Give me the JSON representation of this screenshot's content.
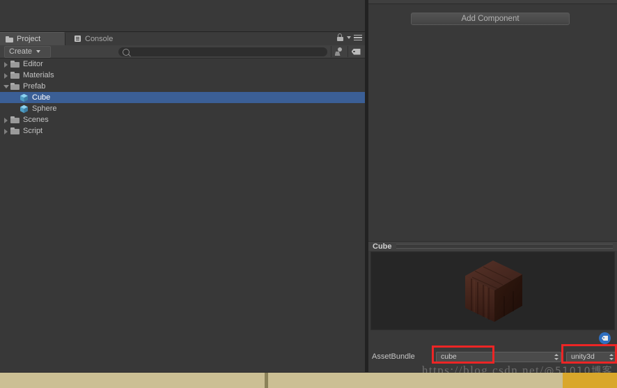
{
  "window": {
    "theme": "unity-dark",
    "accent_selection": "#3b5f96",
    "annotation_color": "#ec2525"
  },
  "project_panel": {
    "tabs": [
      {
        "label": "Project",
        "icon": "folder-icon",
        "active": true
      },
      {
        "label": "Console",
        "icon": "console-icon",
        "active": false
      }
    ],
    "toolbar": {
      "create_label": "Create",
      "search_value": "",
      "search_placeholder": "",
      "icons": [
        "lock-icon",
        "chevron-down-icon",
        "hamburger-menu-icon",
        "avatar-filter-icon",
        "label-filter-icon"
      ]
    },
    "tree": [
      {
        "label": "Editor",
        "icon": "folder-icon",
        "indent": 0,
        "twisty": "closed",
        "selected": false
      },
      {
        "label": "Materials",
        "icon": "folder-icon",
        "indent": 0,
        "twisty": "closed",
        "selected": false
      },
      {
        "label": "Prefab",
        "icon": "folder-icon",
        "indent": 0,
        "twisty": "open",
        "selected": false
      },
      {
        "label": "Cube",
        "icon": "prefab-icon",
        "indent": 1,
        "twisty": "none",
        "selected": true
      },
      {
        "label": "Sphere",
        "icon": "prefab-icon",
        "indent": 1,
        "twisty": "none",
        "selected": false
      },
      {
        "label": "Scenes",
        "icon": "folder-icon",
        "indent": 0,
        "twisty": "closed",
        "selected": false
      },
      {
        "label": "Script",
        "icon": "folder-icon",
        "indent": 0,
        "twisty": "closed",
        "selected": false
      }
    ]
  },
  "inspector": {
    "add_component_label": "Add Component",
    "preview": {
      "title": "Cube",
      "object": "wooden-crate-cube"
    },
    "asset_bundle": {
      "label": "AssetBundle",
      "name_value": "cube",
      "variant_value": "unity3d",
      "tag_icon": "label-icon"
    }
  },
  "watermark": {
    "url": "https://blog.csdn.net/",
    "handle": "@51010博客"
  }
}
